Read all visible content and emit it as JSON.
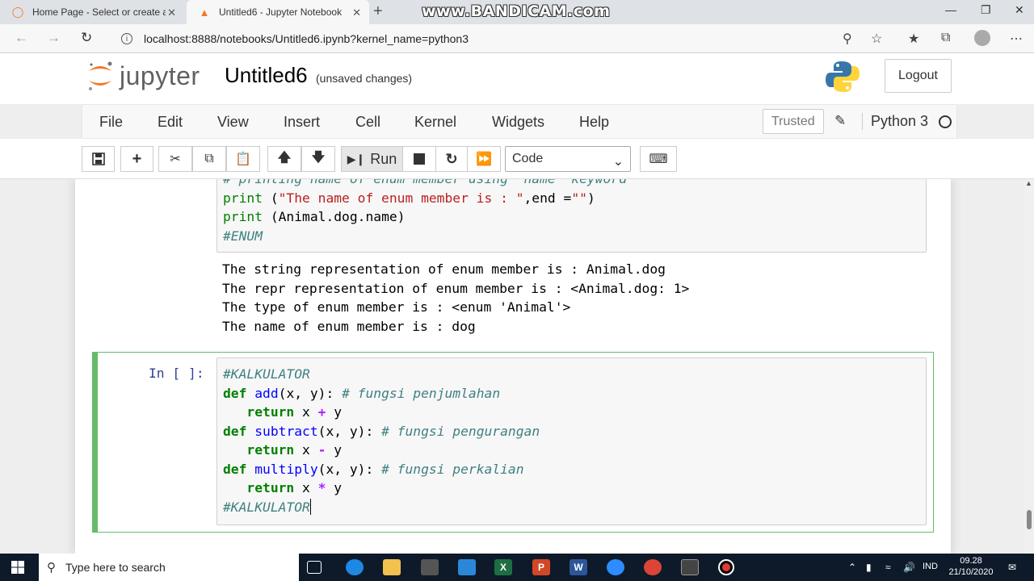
{
  "browser": {
    "tabs": [
      {
        "title": "Home Page - Select or create a n",
        "active": false
      },
      {
        "title": "Untitled6 - Jupyter Notebook",
        "active": true
      }
    ],
    "watermark": "www.BANDICAM.com",
    "url": "localhost:8888/notebooks/Untitled6.ipynb?kernel_name=python3"
  },
  "jupyter": {
    "logo_text": "jupyter",
    "notebook_title": "Untitled6",
    "save_status": "(unsaved changes)",
    "logout_label": "Logout",
    "menu": [
      "File",
      "Edit",
      "View",
      "Insert",
      "Cell",
      "Kernel",
      "Widgets",
      "Help"
    ],
    "trusted_label": "Trusted",
    "kernel_name": "Python 3",
    "run_label": "Run",
    "cell_type": "Code"
  },
  "cells": {
    "cell1": {
      "code_lines": [
        "# printing name of enum member using \"name\" keyword",
        "print (\"The name of enum member is : \",end =\"\")",
        "print (Animal.dog.name)",
        "#ENUM"
      ],
      "output_lines": [
        "The string representation of enum member is : Animal.dog",
        "The repr representation of enum member is : <Animal.dog: 1>",
        "The type of enum member is : <enum 'Animal'>",
        "The name of enum member is : dog"
      ]
    },
    "cell2": {
      "prompt": "In [ ]:",
      "code_lines": [
        "#KALKULATOR",
        "def add(x, y): # fungsi penjumlahan",
        "   return x + y",
        "def subtract(x, y): # fungsi pengurangan",
        "   return x - y",
        "def multiply(x, y): # fungsi perkalian",
        "   return x * y",
        "#KALKULATOR"
      ]
    }
  },
  "taskbar": {
    "search_placeholder": "Type here to search",
    "language": "IND",
    "time": "09.28",
    "date": "21/10/2020"
  },
  "colors": {
    "jupyter_orange": "#f37726",
    "cell_selected_green": "#66bb6a",
    "prompt_blue": "#303f9f",
    "code_keyword": "#008000",
    "code_comment": "#408080",
    "code_def": "#0000ff",
    "code_string": "#ba2121",
    "code_operator": "#aa22ff"
  }
}
